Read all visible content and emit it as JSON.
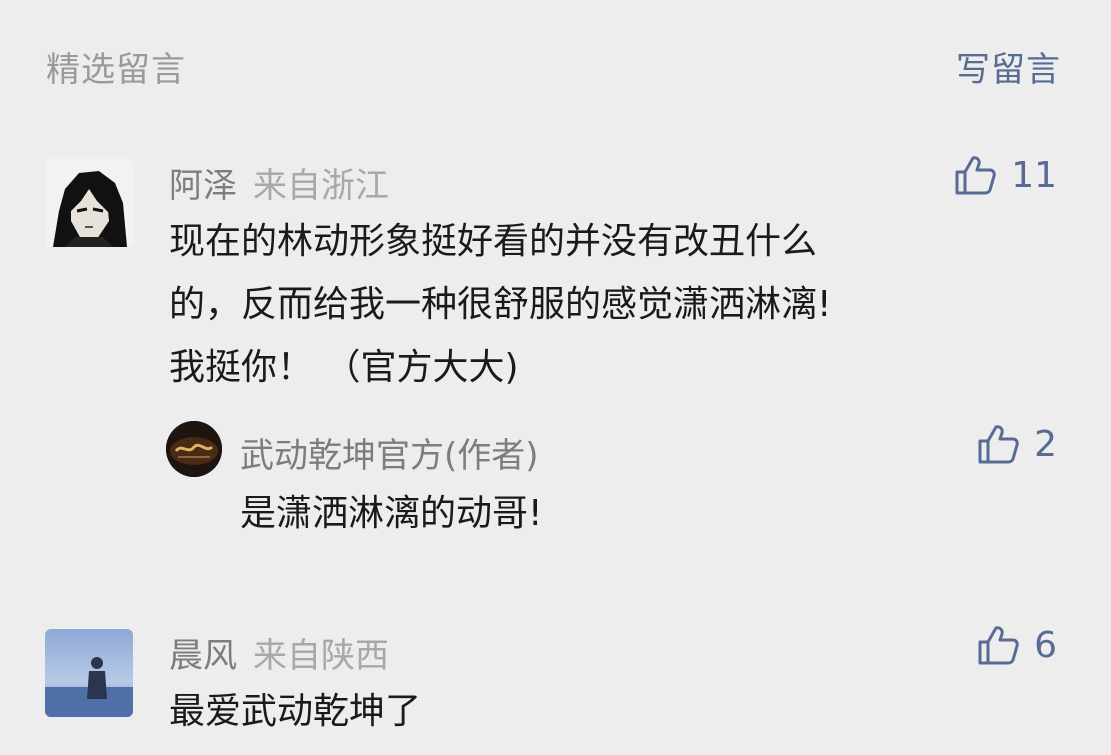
{
  "header": {
    "section_title": "精选留言",
    "write_label": "写留言"
  },
  "colors": {
    "link": "#576b95",
    "muted": "#9a9a9a",
    "background": "#ededed"
  },
  "comments": [
    {
      "name": "阿泽",
      "location": "来自浙江",
      "likes": "11",
      "content_lines": [
        "现在的林动形象挺好看的并没有改丑什么",
        "的，反而给我一种很舒服的感觉潇洒淋漓!",
        "我挺你！ （官方大大)"
      ],
      "reply": {
        "name": "武动乾坤官方(作者)",
        "likes": "2",
        "content": "是潇洒淋漓的动哥!"
      }
    },
    {
      "name": "晨风",
      "location": "来自陕西",
      "likes": "6",
      "content": "最爱武动乾坤了"
    }
  ]
}
